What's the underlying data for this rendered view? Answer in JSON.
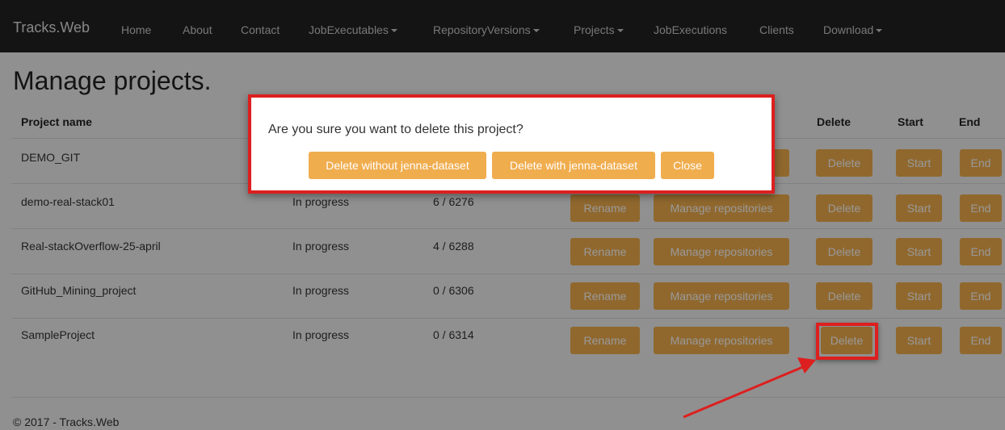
{
  "navbar": {
    "brand": "Tracks.Web",
    "items": [
      {
        "label": "Home",
        "dropdown": false
      },
      {
        "label": "About",
        "dropdown": false
      },
      {
        "label": "Contact",
        "dropdown": false
      },
      {
        "label": "JobExecutables",
        "dropdown": true
      },
      {
        "label": "RepositoryVersions",
        "dropdown": true
      },
      {
        "label": "Projects",
        "dropdown": true
      },
      {
        "label": "JobExecutions",
        "dropdown": false
      },
      {
        "label": "Clients",
        "dropdown": false
      },
      {
        "label": "Download",
        "dropdown": true
      }
    ]
  },
  "page": {
    "title": "Manage projects."
  },
  "table": {
    "headers": {
      "project_name": "Project name",
      "delete": "Delete",
      "start": "Start",
      "end": "End"
    },
    "rows": [
      {
        "name": "DEMO_GIT",
        "status": "",
        "progress": ""
      },
      {
        "name": "demo-real-stack01",
        "status": "In progress",
        "progress": "6 / 6276"
      },
      {
        "name": "Real-stackOverflow-25-april",
        "status": "In progress",
        "progress": "4 / 6288"
      },
      {
        "name": "GitHub_Mining_project",
        "status": "In progress",
        "progress": "0 / 6306"
      },
      {
        "name": "SampleProject",
        "status": "In progress",
        "progress": "0 / 6314"
      }
    ],
    "buttons": {
      "rename": "Rename",
      "manage": "Manage repositories",
      "delete": "Delete",
      "start": "Start",
      "end": "End"
    }
  },
  "modal": {
    "message": "Are you sure you want to delete this project?",
    "delete_without": "Delete without jenna-dataset",
    "delete_with": "Delete with jenna-dataset",
    "close": "Close"
  },
  "footer": {
    "text": "© 2017 - Tracks.Web"
  },
  "colors": {
    "navbar": "#222222",
    "warning_button": "#f0ad4e",
    "annotation_red": "#dd1f1f"
  }
}
